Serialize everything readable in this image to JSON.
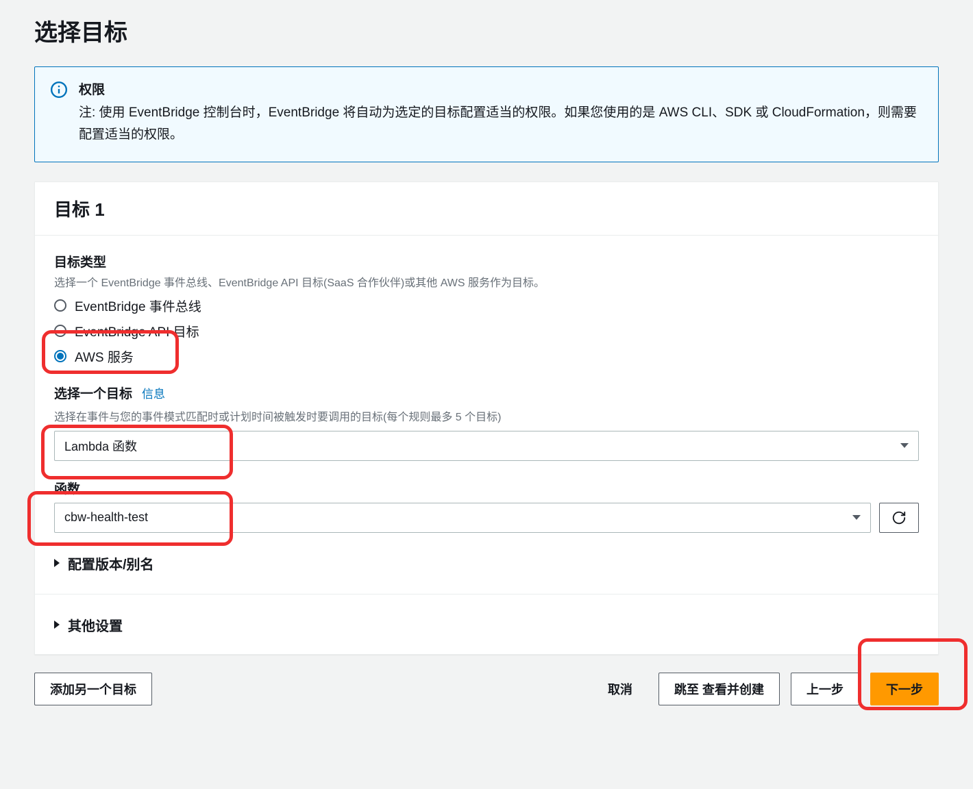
{
  "page": {
    "title": "选择目标"
  },
  "alert": {
    "title": "权限",
    "text": "注: 使用 EventBridge 控制台时，EventBridge 将自动为选定的目标配置适当的权限。如果您使用的是 AWS CLI、SDK 或 CloudFormation，则需要配置适当的权限。"
  },
  "target_panel": {
    "title": "目标 1",
    "type_section": {
      "label": "目标类型",
      "desc": "选择一个 EventBridge 事件总线、EventBridge API 目标(SaaS 合作伙伴)或其他 AWS 服务作为目标。",
      "options": [
        "EventBridge 事件总线",
        "EventBridge API 目标",
        "AWS 服务"
      ],
      "selected_index": 2
    },
    "select_target": {
      "label": "选择一个目标",
      "info": "信息",
      "desc": "选择在事件与您的事件模式匹配时或计划时间被触发时要调用的目标(每个规则最多 5 个目标)",
      "value": "Lambda 函数"
    },
    "function_section": {
      "label": "函数",
      "value": "cbw-health-test"
    },
    "version_alias": "配置版本/别名",
    "other_settings": "其他设置"
  },
  "footer": {
    "add_another": "添加另一个目标",
    "cancel": "取消",
    "skip_review": "跳至 查看并创建",
    "prev": "上一步",
    "next": "下一步"
  }
}
